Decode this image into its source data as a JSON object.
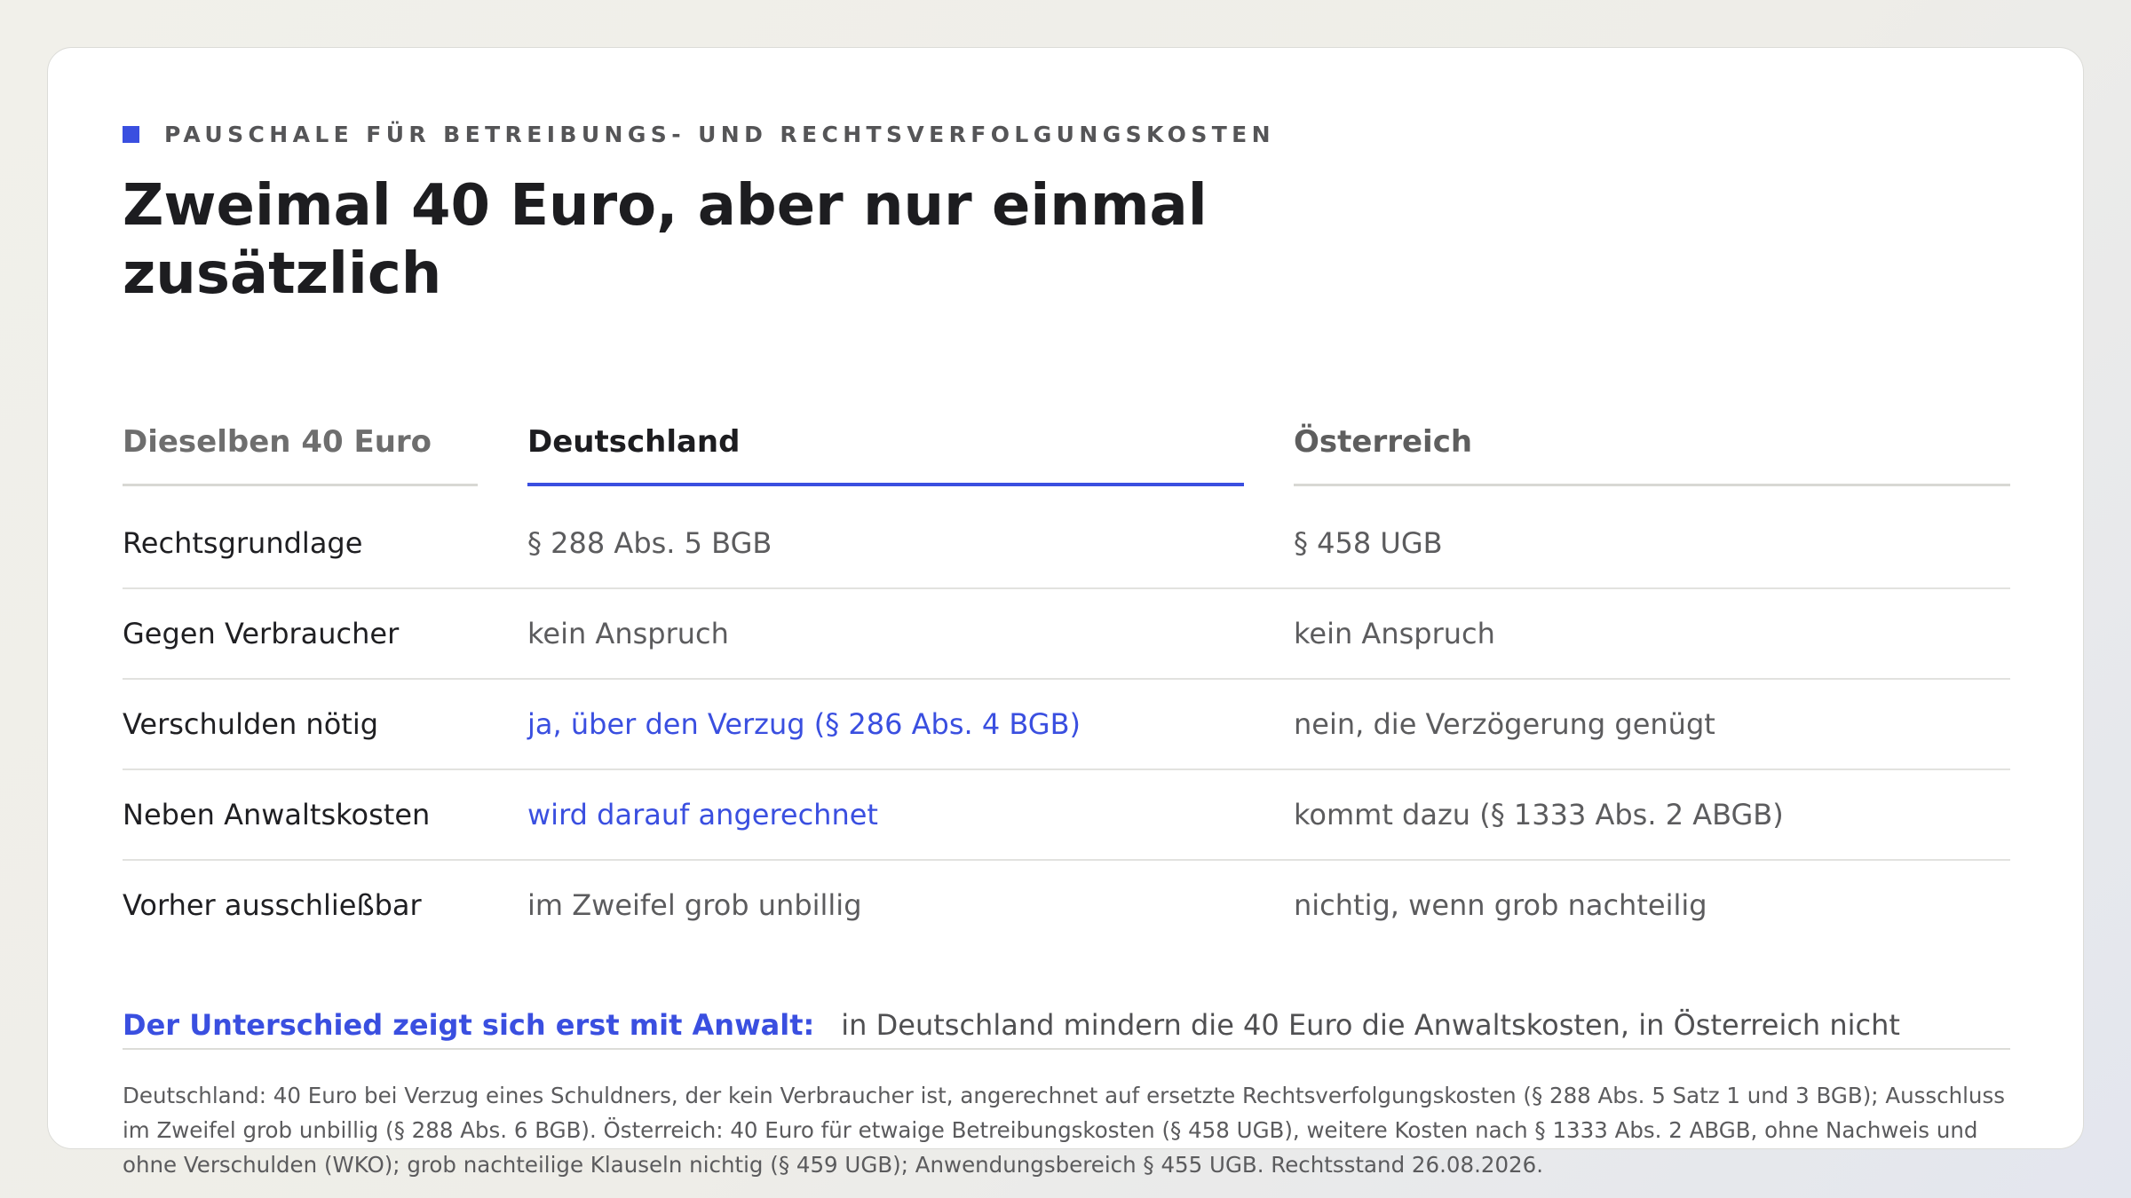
{
  "eyebrow": "PAUSCHALE FÜR BETREIBUNGS- UND RECHTSVERFOLGUNGSKOSTEN",
  "title": "Zweimal 40 Euro, aber nur einmal zusätzlich",
  "table": {
    "headers": [
      "Dieselben 40 Euro",
      "Deutschland",
      "Österreich"
    ],
    "rows": [
      {
        "label": "Rechtsgrundlage",
        "de": "§ 288 Abs. 5 BGB",
        "at": "§ 458 UGB"
      },
      {
        "label": "Gegen Verbraucher",
        "de": "kein Anspruch",
        "at": "kein Anspruch"
      },
      {
        "label": "Verschulden nötig",
        "de": "ja, über den Verzug (§ 286 Abs. 4 BGB)",
        "at": "nein, die Verzögerung genügt"
      },
      {
        "label": "Neben Anwaltskosten",
        "de": "wird darauf angerechnet",
        "at": "kommt dazu (§ 1333 Abs. 2 ABGB)"
      },
      {
        "label": "Vorher ausschließbar",
        "de": "im Zweifel grob unbillig",
        "at": "nichtig, wenn grob nachteilig"
      }
    ]
  },
  "summary": {
    "lead": "Der Unterschied zeigt sich erst mit Anwalt:",
    "text": "in Deutschland mindern die 40 Euro die Anwaltskosten, in Österreich nicht"
  },
  "footnote": "Deutschland: 40 Euro bei Verzug eines Schuldners, der kein Verbraucher ist, angerechnet auf ersetzte Rechtsverfolgungskosten (§ 288 Abs. 5 Satz 1 und 3 BGB); Ausschluss im Zweifel grob unbillig (§ 288 Abs. 6 BGB). Österreich: 40 Euro für etwaige Betreibungskosten (§ 458 UGB), weitere Kosten nach § 1333 Abs. 2 ABGB, ohne Nachweis und ohne Verschulden (WKO); grob nachteilige Klauseln nichtig (§ 459 UGB); Anwendungsbereich § 455 UGB. Rechtsstand 26.08.2026.",
  "colors": {
    "accent": "#3a4fe0",
    "text": "#1f1f22",
    "muted": "#5c5c5e"
  }
}
